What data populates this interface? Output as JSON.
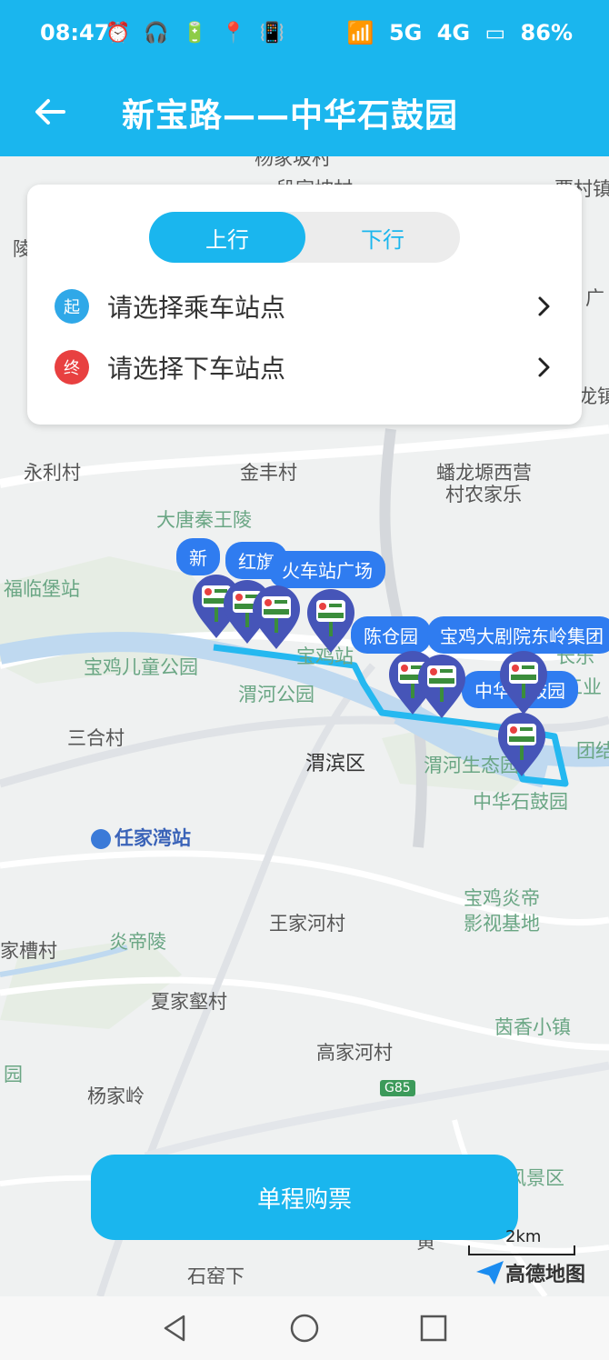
{
  "status": {
    "time": "08:47",
    "left_icons": "⏰ 🎧 🔋 📍 📳",
    "network1": "5G",
    "network2": "4G",
    "battery": "86%"
  },
  "header": {
    "title": "新宝路——中华石鼓园"
  },
  "direction": {
    "up": "上行",
    "down": "下行",
    "selected": "上行"
  },
  "stops": {
    "start_badge": "起",
    "start_text": "请选择乘车站点",
    "end_badge": "终",
    "end_text": "请选择下车站点"
  },
  "colors": {
    "accent": "#1ab6ee",
    "start": "#2fa8e8",
    "end": "#e84040",
    "route": "#25b8f0",
    "pin": "#4655b8",
    "bubble": "#2f7cf0"
  },
  "map_labels": {
    "l1": "杨家坡村",
    "l2": "段家坡村",
    "l3": "贾村镇",
    "l4": "陵",
    "l5": "广",
    "l6": "龙镇",
    "l7": "永利村",
    "l8": "金丰村",
    "l9": "蟠龙塬西营",
    "l10": "村农家乐",
    "l11": "大唐秦王陵",
    "l12": "福临堡站",
    "l13": "宝鸡儿童公园",
    "l14": "渭河公园",
    "l15": "三合村",
    "l16": "渭滨区",
    "l17": "渭河生态园",
    "l18": "中华石鼓园",
    "l19": "团结",
    "l20": "任家湾站",
    "l21": "宝鸡炎帝",
    "l22": "影视基地",
    "l23": "王家河村",
    "l24": "炎帝陵",
    "l25": "家槽村",
    "l26": "夏家壑村",
    "l27": "茵香小镇",
    "l28": "高家河村",
    "l29": "园",
    "l30": "杨家岭",
    "l31": "G85",
    "l32": "风景区",
    "l33": "石窑下",
    "l34": "黄",
    "l35": "长乐",
    "l36": "工业",
    "l37": "宝鸡站"
  },
  "stations": {
    "s1": "新",
    "s2": "红旗",
    "s3": "火车站广场",
    "s4": "陈仓园",
    "s5": "宝鸡大剧院东岭集团",
    "s6": "中华石鼓园"
  },
  "buy_button": "单程购票",
  "scale": "2km",
  "logo": "高德地图",
  "nav": {
    "back": "back-triangle",
    "home": "home-circle",
    "recent": "recent-square"
  }
}
